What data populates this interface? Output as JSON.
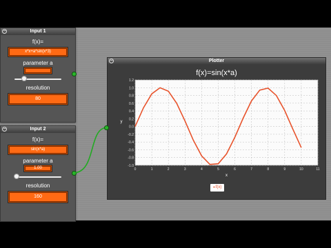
{
  "colors": {
    "accent": "#ff6a14",
    "curve": "#e8532c",
    "port": "#2bb52b"
  },
  "input1": {
    "title": "Input 1",
    "f_label": "f(x)=",
    "expression": "x*x+a*sin(x*3)",
    "param_label": "parameter a",
    "param_value": "",
    "param_fraction": 0.2,
    "res_label": "resolution",
    "res_value": "80"
  },
  "input2": {
    "title": "Input 2",
    "f_label": "f(x)=",
    "expression": "sin(x*a)",
    "param_label": "parameter a",
    "param_value": "1.00",
    "param_fraction": 0.05,
    "res_label": "resolution",
    "res_value": "160"
  },
  "plotter": {
    "title": "Plotter",
    "legend": "f(x)"
  },
  "chart_data": {
    "type": "line",
    "title": "f(x)=sin(x*a)",
    "xlabel": "x",
    "ylabel": "y",
    "xlim": [
      0,
      11
    ],
    "ylim": [
      -1.0,
      1.2
    ],
    "x_ticks": [
      "0",
      "1",
      "2",
      "3",
      "4",
      "5",
      "6",
      "7",
      "8",
      "9",
      "10",
      "11"
    ],
    "y_ticks": [
      "-1.0",
      "-0.8",
      "-0.6",
      "-0.4",
      "-0.2",
      "0.0",
      "0.2",
      "0.4",
      "0.6",
      "0.8",
      "1.0",
      "1.2"
    ],
    "grid": true,
    "series": [
      {
        "name": "f(x)",
        "x": [
          0,
          0.5,
          1,
          1.5,
          2,
          2.5,
          3,
          3.5,
          4,
          4.5,
          5,
          5.5,
          6,
          6.5,
          7,
          7.5,
          8,
          8.5,
          9,
          9.5,
          10
        ],
        "y": [
          0,
          0.479,
          0.841,
          0.997,
          0.909,
          0.598,
          0.141,
          -0.351,
          -0.757,
          -0.977,
          -0.959,
          -0.706,
          -0.279,
          0.215,
          0.657,
          0.938,
          0.989,
          0.798,
          0.412,
          -0.075,
          -0.544
        ]
      }
    ]
  }
}
